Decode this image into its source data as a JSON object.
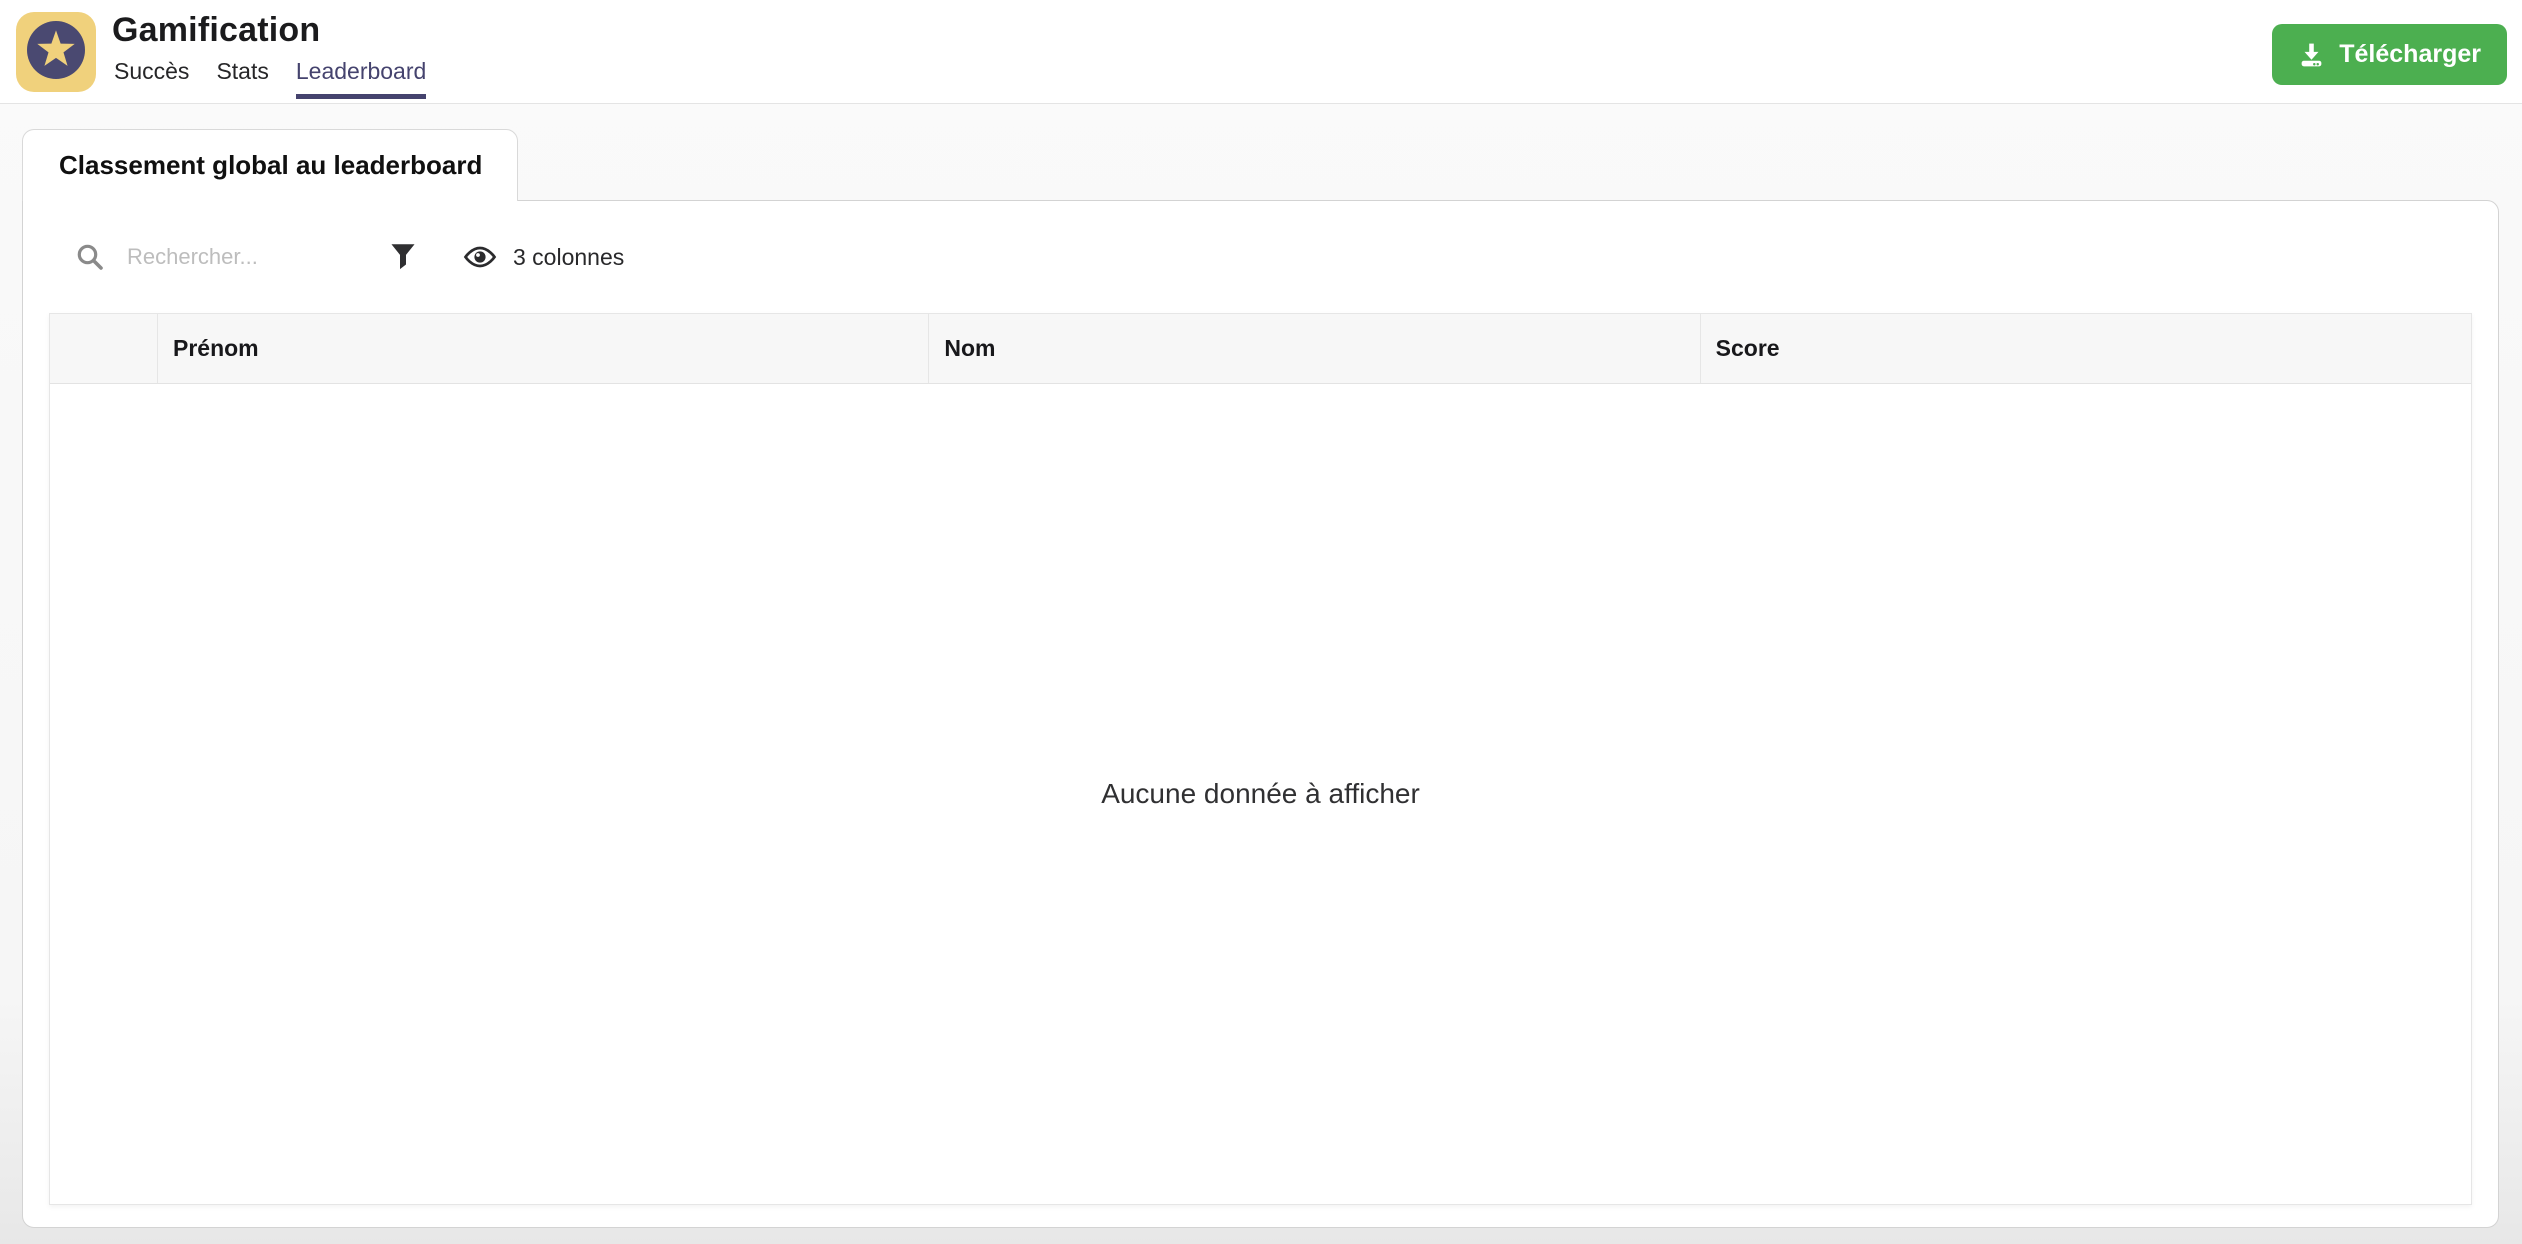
{
  "app": {
    "title": "Gamification"
  },
  "nav": {
    "tabs": [
      {
        "label": "Succès",
        "active": false
      },
      {
        "label": "Stats",
        "active": false
      },
      {
        "label": "Leaderboard",
        "active": true
      }
    ]
  },
  "header": {
    "download_button": {
      "label": "Télécharger",
      "icon": "download-icon",
      "color": "#4caf50"
    }
  },
  "panel": {
    "tab_title": "Classement global au leaderboard",
    "toolbar": {
      "search_placeholder": "Rechercher...",
      "search_value": "",
      "filter_icon": "funnel-icon",
      "columns_toggle": {
        "icon": "eye-icon",
        "label": "3 colonnes"
      }
    },
    "table": {
      "columns": [
        "",
        "Prénom",
        "Nom",
        "Score"
      ],
      "rows": [],
      "empty_message": "Aucune donnée à afficher"
    }
  },
  "colors": {
    "accent_purple": "#45436e",
    "button_green": "#4caf50",
    "logo_yellow": "#f0d17c",
    "logo_indigo": "#4a4971"
  }
}
